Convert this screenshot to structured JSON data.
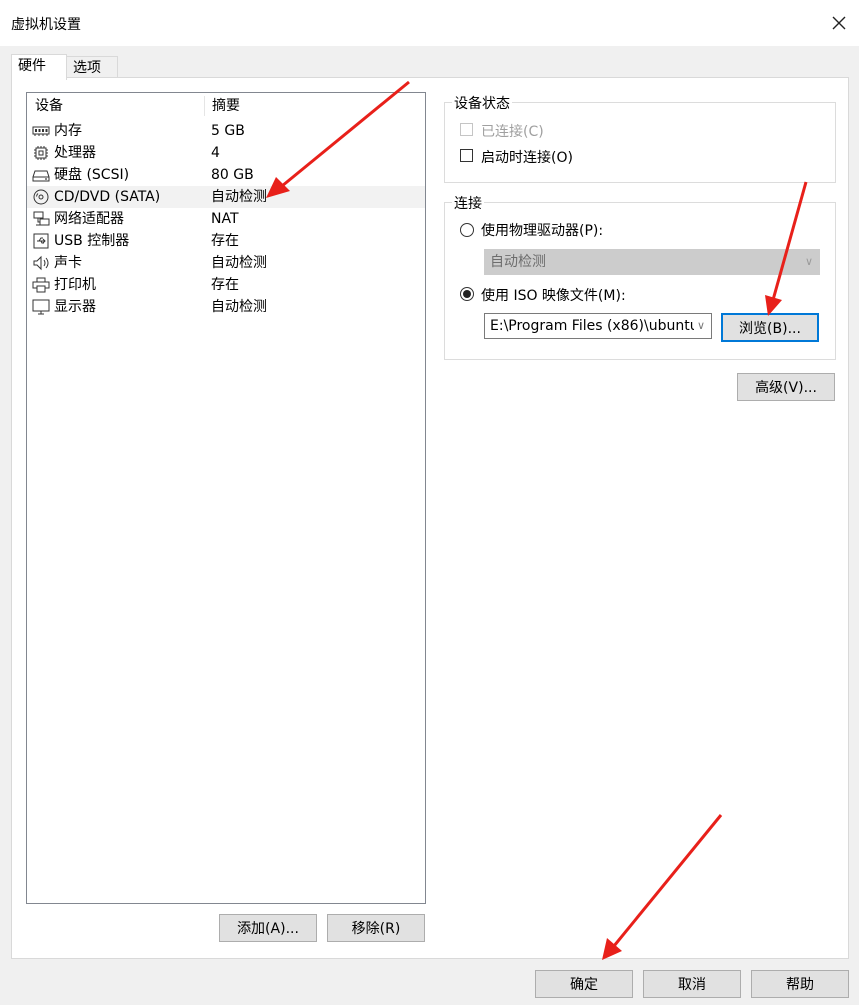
{
  "window": {
    "title": "虚拟机设置"
  },
  "tabs": [
    {
      "label": "硬件",
      "active": true
    },
    {
      "label": "选项",
      "active": false
    }
  ],
  "device_list": {
    "columns": [
      "设备",
      "摘要"
    ],
    "rows": [
      {
        "icon": "memory-icon",
        "device": "内存",
        "summary": "5 GB",
        "selected": false
      },
      {
        "icon": "processor-icon",
        "device": "处理器",
        "summary": "4",
        "selected": false
      },
      {
        "icon": "hard-disk-icon",
        "device": "硬盘 (SCSI)",
        "summary": "80 GB",
        "selected": false
      },
      {
        "icon": "cd-dvd-icon",
        "device": "CD/DVD (SATA)",
        "summary": "自动检测",
        "selected": true
      },
      {
        "icon": "network-adapter-icon",
        "device": "网络适配器",
        "summary": "NAT",
        "selected": false
      },
      {
        "icon": "usb-icon",
        "device": "USB 控制器",
        "summary": "存在",
        "selected": false
      },
      {
        "icon": "sound-card-icon",
        "device": "声卡",
        "summary": "自动检测",
        "selected": false
      },
      {
        "icon": "printer-icon",
        "device": "打印机",
        "summary": "存在",
        "selected": false
      },
      {
        "icon": "display-icon",
        "device": "显示器",
        "summary": "自动检测",
        "selected": false
      }
    ]
  },
  "list_buttons": {
    "add": "添加(A)...",
    "remove": "移除(R)"
  },
  "device_status": {
    "title": "设备状态",
    "connected": {
      "label": "已连接(C)",
      "checked": false,
      "disabled": true
    },
    "connect_at_power_on": {
      "label": "启动时连接(O)",
      "checked": false,
      "disabled": false
    }
  },
  "connection": {
    "title": "连接",
    "physical_drive": {
      "label": "使用物理驱动器(P):",
      "selected": false,
      "value": "自动检测"
    },
    "iso_image": {
      "label": "使用 ISO 映像文件(M):",
      "selected": true,
      "value": "E:\\Program Files (x86)\\ubuntu"
    },
    "browse": "浏览(B)..."
  },
  "advanced": "高级(V)...",
  "footer": {
    "ok": "确定",
    "cancel": "取消",
    "help": "帮助"
  },
  "colors": {
    "focus": "#0078d7",
    "annotation_arrow": "#e8201a",
    "selected_row": "#f2f2f2"
  }
}
